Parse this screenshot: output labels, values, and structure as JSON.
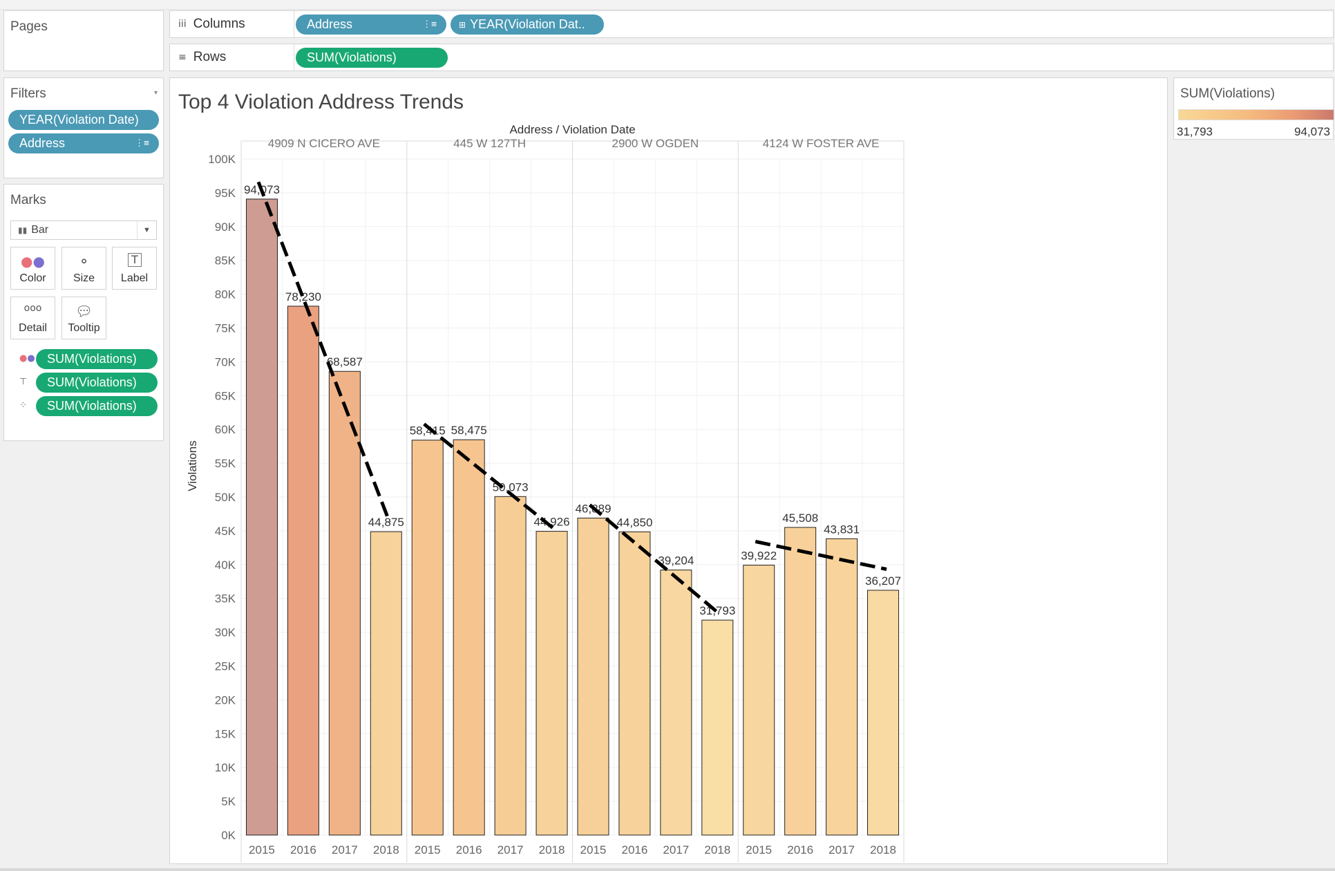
{
  "pages": {
    "title": "Pages"
  },
  "columns": {
    "label": "Columns",
    "icon": "iii",
    "pills": [
      {
        "label": "Address",
        "icon": "sort-desc-icon"
      },
      {
        "label": "YEAR(Violation Dat..",
        "icon": "expand-plus-icon"
      }
    ]
  },
  "rows": {
    "label": "Rows",
    "icon": "≡",
    "pills": [
      {
        "label": "SUM(Violations)"
      }
    ]
  },
  "filters": {
    "title": "Filters",
    "pills": [
      {
        "label": "YEAR(Violation Date)"
      },
      {
        "label": "Address",
        "icon": "sort-desc-icon"
      }
    ]
  },
  "marks": {
    "title": "Marks",
    "mark_type": "Bar",
    "buttons": [
      {
        "label": "Color",
        "icon": "color-dots-icon"
      },
      {
        "label": "Size",
        "icon": "size-circles-icon"
      },
      {
        "label": "Label",
        "icon": "label-text-icon"
      },
      {
        "label": "Detail",
        "icon": "detail-dots-icon"
      },
      {
        "label": "Tooltip",
        "icon": "tooltip-bubble-icon"
      }
    ],
    "fields": [
      {
        "label": "SUM(Violations)",
        "icon": "color-dots-icon"
      },
      {
        "label": "SUM(Violations)",
        "icon": "label-text-icon"
      },
      {
        "label": "SUM(Violations)",
        "icon": "detail-dots-icon"
      }
    ]
  },
  "legend": {
    "title": "SUM(Violations)",
    "min": "31,793",
    "max": "94,073",
    "color_low": "#f9d896",
    "color_high": "#c97a6c"
  },
  "view": {
    "title": "Top 4 Violation Address Trends"
  },
  "chart_data": {
    "type": "bar",
    "title": "Top 4 Violation Address Trends",
    "header": "Address / Violation Date",
    "ylabel": "Violations",
    "ylim": [
      0,
      100000
    ],
    "yticks": [
      0,
      5000,
      10000,
      15000,
      20000,
      25000,
      30000,
      35000,
      40000,
      45000,
      50000,
      55000,
      60000,
      65000,
      70000,
      75000,
      80000,
      85000,
      90000,
      95000,
      100000
    ],
    "ytick_labels": [
      "0K",
      "5K",
      "10K",
      "15K",
      "20K",
      "25K",
      "30K",
      "35K",
      "40K",
      "45K",
      "50K",
      "55K",
      "60K",
      "65K",
      "70K",
      "75K",
      "80K",
      "85K",
      "90K",
      "95K",
      "100K"
    ],
    "trend_lines": true,
    "grid": true,
    "groups": [
      {
        "name": "4909 N CICERO AVE",
        "years": [
          "2015",
          "2016",
          "2017",
          "2018"
        ],
        "values": [
          94073,
          78230,
          68587,
          44875
        ],
        "labels": [
          "94,073",
          "78,230",
          "68,587",
          "44,875"
        ]
      },
      {
        "name": "445 W 127TH",
        "years": [
          "2015",
          "2016",
          "2017",
          "2018"
        ],
        "values": [
          58415,
          58475,
          50073,
          44926
        ],
        "labels": [
          "58,415",
          "58,475",
          "50,073",
          "44,926"
        ]
      },
      {
        "name": "2900 W OGDEN",
        "years": [
          "2015",
          "2016",
          "2017",
          "2018"
        ],
        "values": [
          46889,
          44850,
          39204,
          31793
        ],
        "labels": [
          "46,889",
          "44,850",
          "39,204",
          "31,793"
        ]
      },
      {
        "name": "4124 W FOSTER AVE",
        "years": [
          "2015",
          "2016",
          "2017",
          "2018"
        ],
        "values": [
          39922,
          45508,
          43831,
          36207
        ],
        "labels": [
          "39,922",
          "45,508",
          "43,831",
          "36,207"
        ]
      }
    ]
  }
}
